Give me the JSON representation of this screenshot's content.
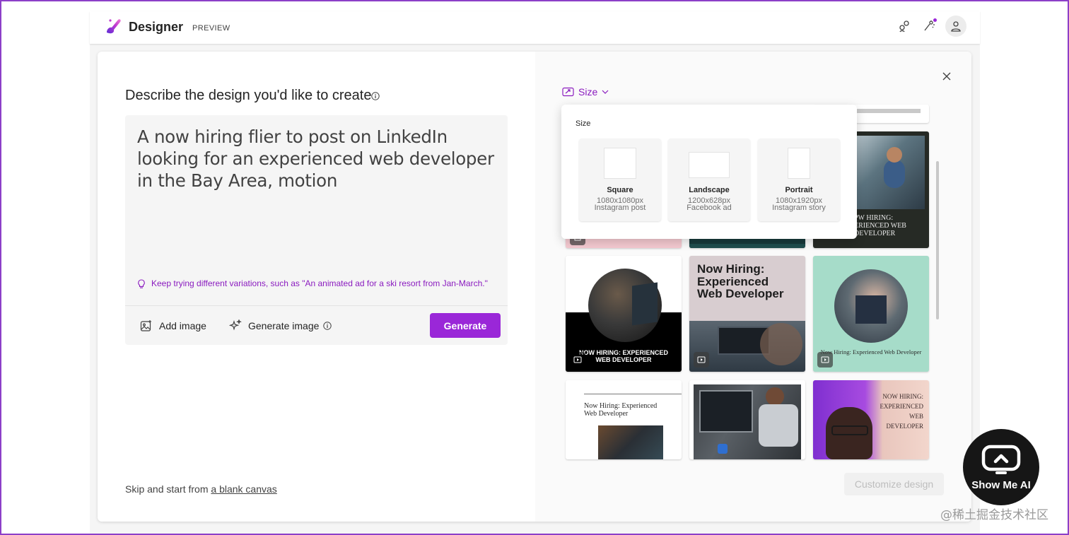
{
  "header": {
    "app_title": "Designer",
    "preview_tag": "PREVIEW",
    "icons": [
      "share-icon",
      "wand-icon",
      "account-icon"
    ]
  },
  "left": {
    "heading": "Describe the design you'd like to create",
    "prompt": "A now hiring flier to post on LinkedIn looking for an experienced web developer in the Bay Area, motion",
    "tip": "Keep trying different variations, such as \"An animated ad for a ski resort from Jan-March.\"",
    "add_image": "Add image",
    "generate_image": "Generate image",
    "generate": "Generate",
    "skip_prefix": "Skip and start from ",
    "skip_link": "a blank canvas"
  },
  "right": {
    "size_label": "Size",
    "customize": "Customize design",
    "popup": {
      "title": "Size",
      "options": [
        {
          "name": "Square",
          "dims": "1080x1080px",
          "use": "Instagram post"
        },
        {
          "name": "Landscape",
          "dims": "1200x628px",
          "use": "Facebook ad"
        },
        {
          "name": "Portrait",
          "dims": "1080x1920px",
          "use": "Instagram story"
        }
      ]
    },
    "thumbs": {
      "t1": "PW HIRING: ERIENCED WEB DEVELOPER",
      "t2": "NOW HIRING: EXPERIENCED WEB DEVELOPER",
      "t3": "Now Hiring: Experienced Web Developer",
      "t4": "Now Hiring: Experienced Web Developer",
      "t5": "Now Hiring: Experienced Web Developer",
      "t6": "NOW HIRING: EXPERIENCED WEB DEVELOPER"
    }
  },
  "watermark": {
    "badge": "Show Me AI",
    "site": "@稀土掘金技术社区"
  },
  "colors": {
    "accent": "#9a27d8",
    "link": "#8a1bbf",
    "frame": "#8c3fc8"
  }
}
